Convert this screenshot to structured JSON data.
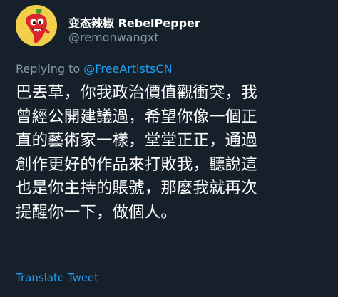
{
  "author": {
    "display_name": "变态辣椒 RebelPepper",
    "handle": "@remonwangxt",
    "avatar": "pepper-avatar-icon"
  },
  "reply": {
    "prefix": "Replying to",
    "mention": "@FreeArtistsCN"
  },
  "tweet": {
    "lines": [
      "巴丟草，你我政治價值觀衝突，我",
      "曾經公開建議過，希望你像一個正",
      "直的藝術家一樣，堂堂正正，通過",
      "創作更好的作品來打敗我，聽說這",
      "也是你主持的賬號，那麼我就再次",
      "提醒你一下，做個人。"
    ]
  },
  "translate_label": "Translate Tweet",
  "colors": {
    "background": "#15202b",
    "text": "#ffffff",
    "muted": "#8899a6",
    "link": "#1da1f2"
  }
}
